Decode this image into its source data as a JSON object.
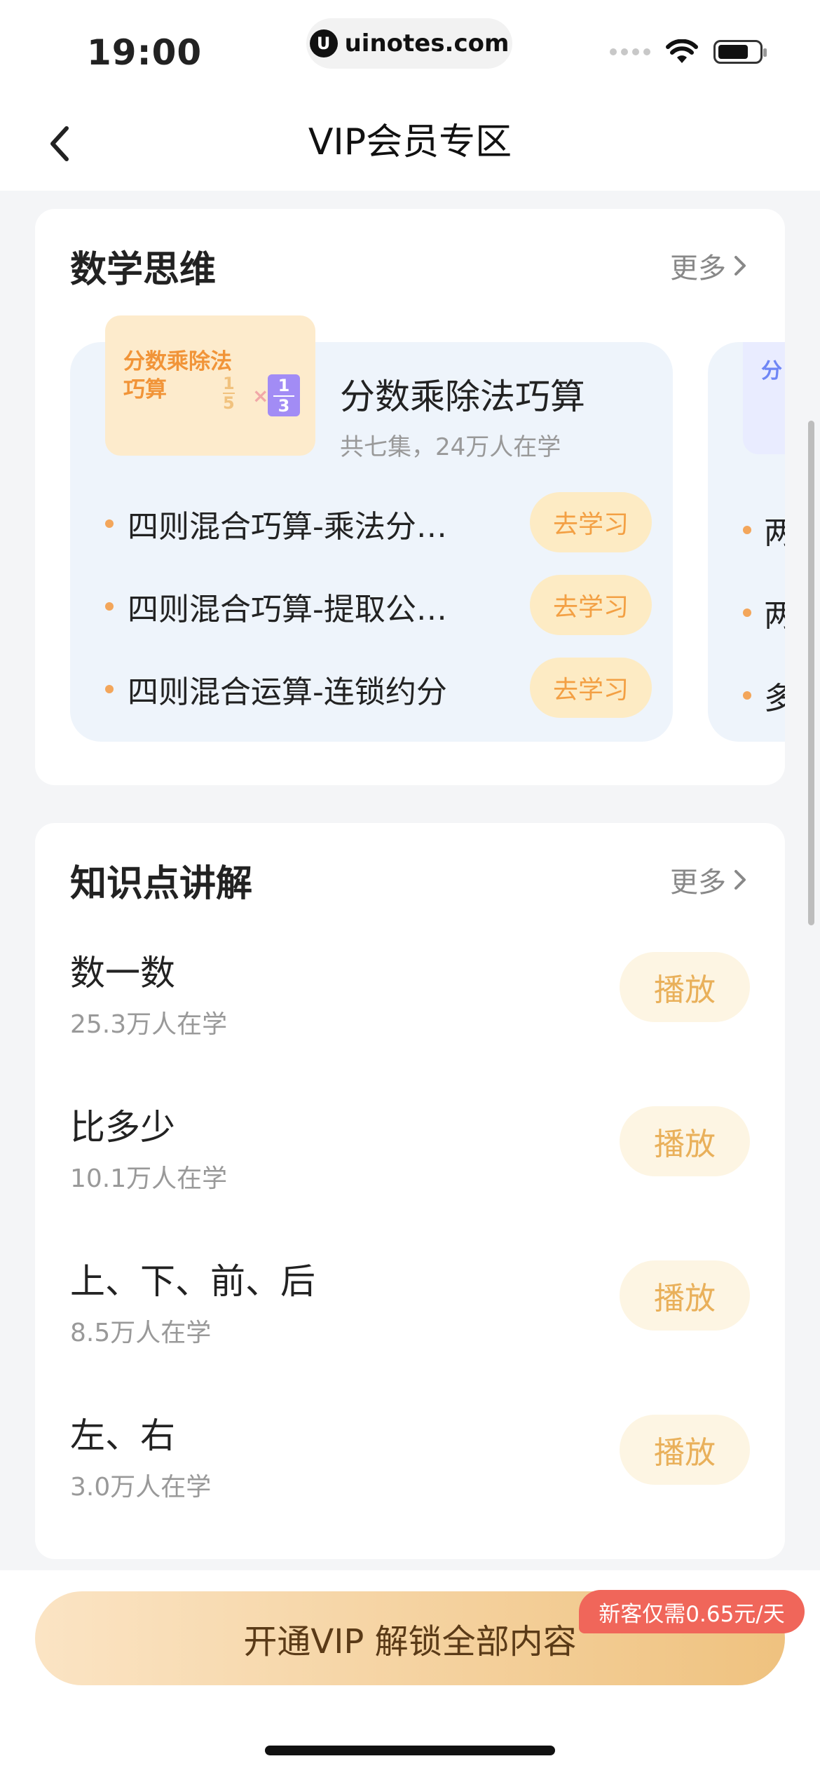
{
  "status_bar": {
    "time": "19:00",
    "url": "uinotes.com",
    "logo_glyph": "U"
  },
  "nav": {
    "title": "VIP会员专区"
  },
  "math_thinking": {
    "title": "数学思维",
    "more": "更多",
    "course": {
      "thumb_text_line1": "分数乘除法",
      "thumb_text_line2": "巧算",
      "thumb_frac_num": "1",
      "thumb_frac_den": "5",
      "thumb_times": "×",
      "thumb_box_num": "1",
      "thumb_box_den": "3",
      "title": "分数乘除法巧算",
      "subtitle": "共七集，24万人在学",
      "lessons": [
        {
          "title": "四则混合巧算-乘法分…",
          "button": "去学习"
        },
        {
          "title": "四则混合巧算-提取公…",
          "button": "去学习"
        },
        {
          "title": "四则混合运算-连锁约分",
          "button": "去学习"
        }
      ]
    },
    "next_course_peek": {
      "thumb_char": "分",
      "lines": [
        "两",
        "两",
        "多"
      ]
    }
  },
  "knowledge": {
    "title": "知识点讲解",
    "more": "更多",
    "items": [
      {
        "title": "数一数",
        "learners": "25.3万人在学",
        "button": "播放"
      },
      {
        "title": "比多少",
        "learners": "10.1万人在学",
        "button": "播放"
      },
      {
        "title": "上、下、前、后",
        "learners": "8.5万人在学",
        "button": "播放"
      },
      {
        "title": "左、右",
        "learners": "3.0万人在学",
        "button": "播放"
      }
    ]
  },
  "cta": {
    "label": "开通VIP 解锁全部内容",
    "promo": "新客仅需0.65元/天"
  },
  "colors": {
    "accent_orange": "#f3a044",
    "cta_start": "#fbe4c4",
    "cta_end": "#efc27f",
    "promo_red": "#f0665a"
  }
}
